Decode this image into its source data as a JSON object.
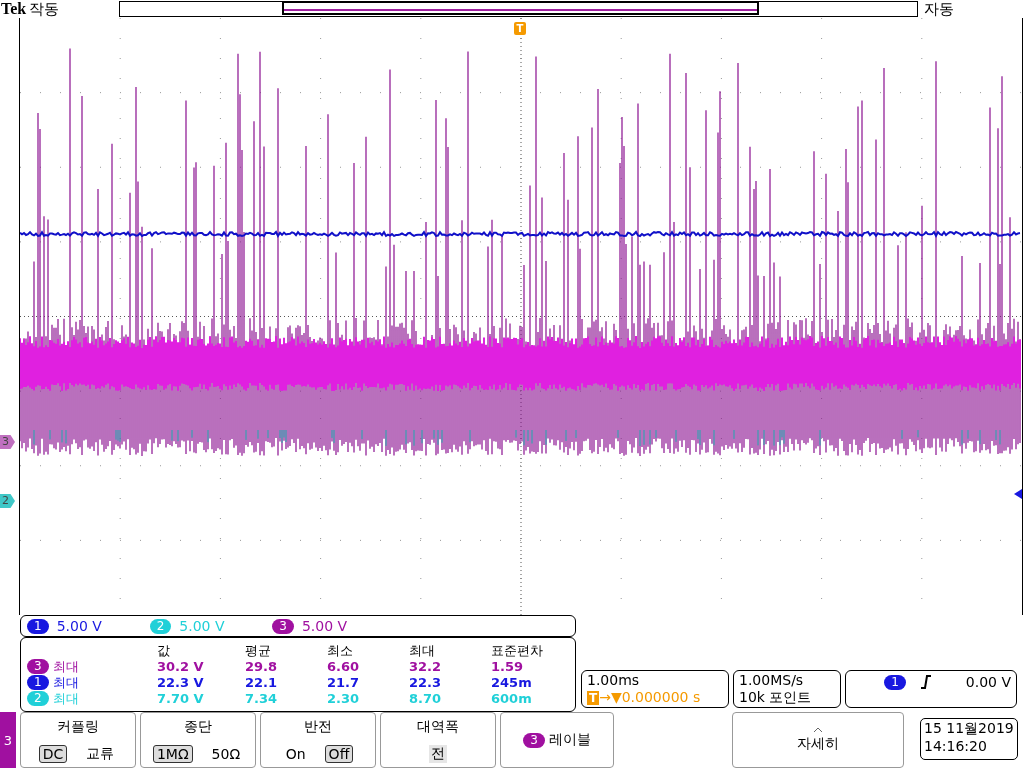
{
  "header": {
    "brand": "Tek",
    "run_state": "작동",
    "trigger_mode": "자동",
    "trigger_marker": "T"
  },
  "ground_markers": [
    {
      "label": "3",
      "color": "#c070c0"
    },
    {
      "label": "2",
      "color": "#40c8c8"
    }
  ],
  "channel_scales": [
    {
      "channel": "1",
      "scale": "5.00 V",
      "color": "#1818e0"
    },
    {
      "channel": "2",
      "scale": "5.00 V",
      "color": "#20d0d8"
    },
    {
      "channel": "3",
      "scale": "5.00 V",
      "color": "#a010a0"
    }
  ],
  "measurements": {
    "columns": [
      "값",
      "평균",
      "최소",
      "최대",
      "표준편차"
    ],
    "rows": [
      {
        "channel": "3",
        "type": "최대",
        "color": "#a010a0",
        "values": [
          "30.2 V",
          "29.8",
          "6.60",
          "32.2",
          "1.59"
        ]
      },
      {
        "channel": "1",
        "type": "최대",
        "color": "#1818e0",
        "values": [
          "22.3 V",
          "22.1",
          "21.7",
          "22.3",
          "245m"
        ]
      },
      {
        "channel": "2",
        "type": "최대",
        "color": "#20d0d8",
        "values": [
          "7.70 V",
          "7.34",
          "2.30",
          "8.70",
          "600m"
        ]
      }
    ]
  },
  "timebase": {
    "scale": "1.00ms",
    "marker": "T",
    "arrow": "→▼",
    "position": "0.000000 s"
  },
  "acquisition": {
    "rate": "1.00MS/s",
    "record": "10k 포인트"
  },
  "trigger": {
    "channel": "1",
    "color": "#1818e0",
    "level": "0.00 V"
  },
  "menu": {
    "channel": "3",
    "buttons": [
      {
        "kind": "choice",
        "label": "커플링",
        "options": [
          {
            "label": "DC",
            "selected": true
          },
          {
            "label": "교류",
            "selected": false
          }
        ]
      },
      {
        "kind": "choice",
        "label": "종단",
        "options": [
          {
            "label": "1MΩ",
            "selected": true
          },
          {
            "label": "50Ω",
            "selected": false
          }
        ]
      },
      {
        "kind": "choice",
        "label": "반전",
        "options": [
          {
            "label": "On",
            "selected": false
          },
          {
            "label": "Off",
            "selected": true
          }
        ]
      },
      {
        "kind": "value",
        "label": "대역폭",
        "value": "전"
      },
      {
        "kind": "label",
        "channel": "3",
        "label": "레이블"
      },
      {
        "kind": "more",
        "label": "자세히"
      }
    ]
  },
  "datetime": {
    "date": "15 11월2019",
    "time": "14:16:20"
  }
}
